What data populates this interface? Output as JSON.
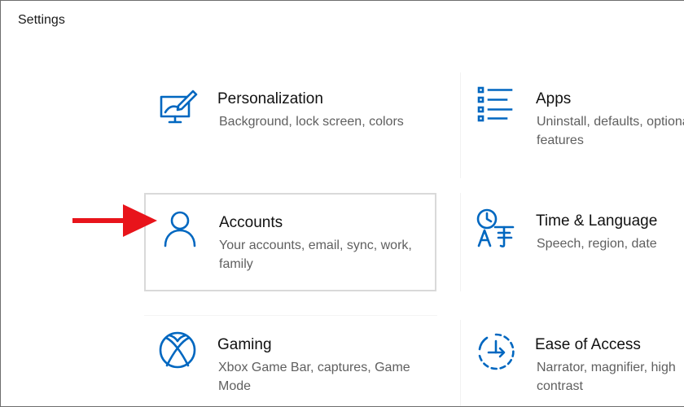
{
  "window": {
    "title": "Settings"
  },
  "tiles": {
    "personalization": {
      "name": "Personalization",
      "desc": "Background, lock screen, colors",
      "icon": "personalization-icon"
    },
    "apps": {
      "name": "Apps",
      "desc": "Uninstall, defaults, optional features",
      "icon": "apps-icon"
    },
    "accounts": {
      "name": "Accounts",
      "desc": "Your accounts, email, sync, work, family",
      "icon": "person-icon"
    },
    "time_language": {
      "name": "Time & Language",
      "desc": "Speech, region, date",
      "icon": "time-language-icon"
    },
    "gaming": {
      "name": "Gaming",
      "desc": "Xbox Game Bar, captures, Game Mode",
      "icon": "xbox-icon"
    },
    "ease_of_access": {
      "name": "Ease of Access",
      "desc": "Narrator, magnifier, high contrast",
      "icon": "ease-of-access-icon"
    }
  },
  "colors": {
    "accent": "#0067c0",
    "arrow": "#e8141b",
    "selected_border": "#d9d9d9"
  }
}
